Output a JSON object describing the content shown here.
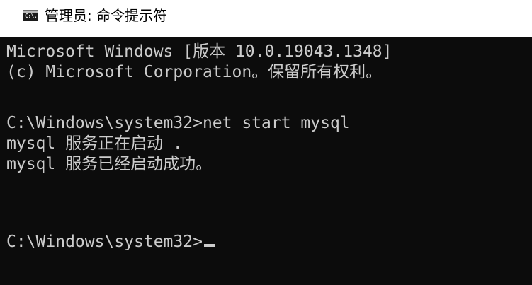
{
  "window": {
    "title": "管理员: 命令提示符",
    "icon": "cmd-icon",
    "icon_text": "C:\\."
  },
  "console": {
    "lines": [
      "Microsoft Windows [版本 10.0.19043.1348]",
      "(c) Microsoft Corporation。保留所有权利。",
      "",
      "C:\\Windows\\system32>net start mysql",
      "mysql 服务正在启动 .",
      "mysql 服务已经启动成功。",
      "",
      "",
      "C:\\Windows\\system32>"
    ],
    "background_color": "#0c0c0c",
    "text_color": "#cccccc"
  }
}
